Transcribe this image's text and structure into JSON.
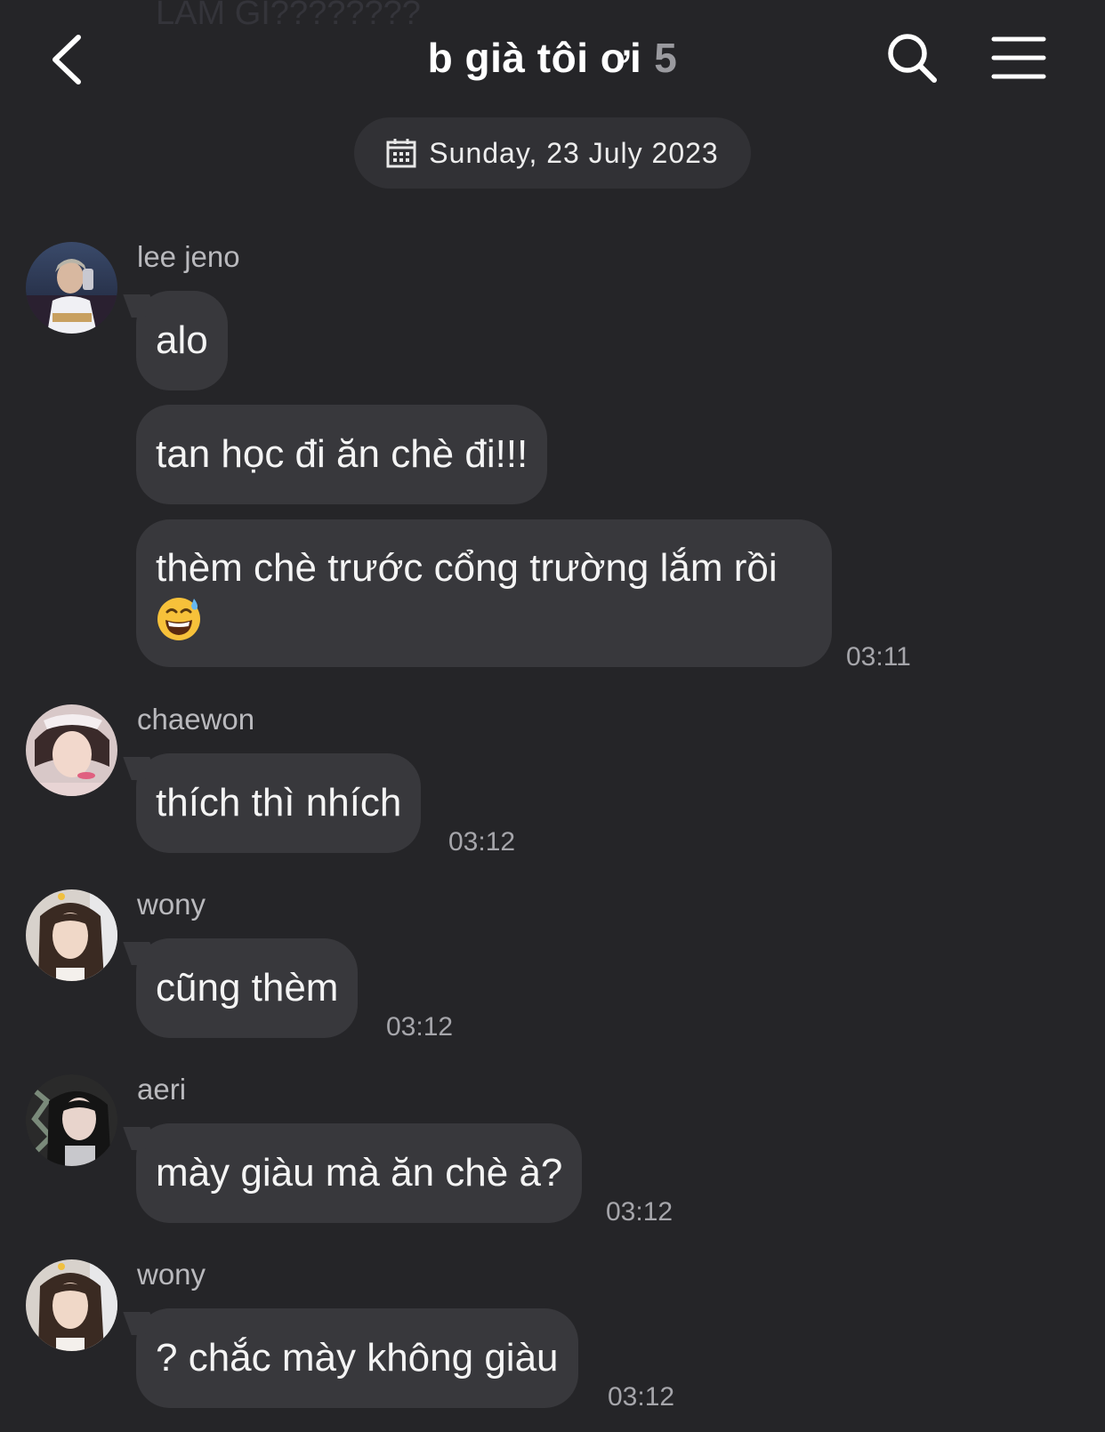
{
  "ghost": {
    "text": "LÀM GÌ????????"
  },
  "header": {
    "title": "b già tôi ơi",
    "member_count": "5"
  },
  "date_label": "Sunday, 23 July 2023",
  "messages": [
    {
      "sender": "lee jeno",
      "lines": [
        "alo",
        "tan học đi ăn chè đi!!!",
        "thèm chè trước cổng trường lắm rồi"
      ],
      "emoji": "sweat-smile",
      "time": "03:11"
    },
    {
      "sender": "chaewon",
      "text": "thích thì nhích",
      "time": "03:12"
    },
    {
      "sender": "wony",
      "text": "cũng thèm",
      "time": "03:12"
    },
    {
      "sender": "aeri",
      "text": "mày giàu mà ăn chè à?",
      "time": "03:12"
    },
    {
      "sender": "wony",
      "text": "? chắc mày không giàu",
      "time": "03:12"
    }
  ],
  "colors": {
    "background": "#252528",
    "bubble": "#38383c",
    "timestamp": "#a6a6ab"
  }
}
